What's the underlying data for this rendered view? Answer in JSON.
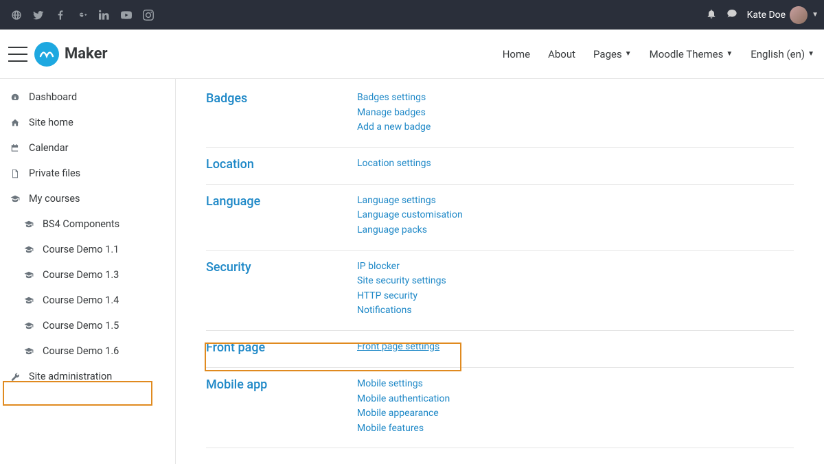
{
  "topbar": {
    "user_name": "Kate Doe"
  },
  "header": {
    "brand": "Maker",
    "nav": {
      "home": "Home",
      "about": "About",
      "pages": "Pages",
      "themes": "Moodle Themes",
      "lang": "English (en)"
    }
  },
  "sidebar": {
    "dashboard": "Dashboard",
    "sitehome": "Site home",
    "calendar": "Calendar",
    "privatefiles": "Private files",
    "mycourses": "My courses",
    "courses": [
      "BS4 Components",
      "Course Demo 1.1",
      "Course Demo 1.3",
      "Course Demo 1.4",
      "Course Demo 1.5",
      "Course Demo 1.6"
    ],
    "siteadmin": "Site administration"
  },
  "sections": {
    "badges": {
      "title": "Badges",
      "links": [
        "Badges settings",
        "Manage badges",
        "Add a new badge"
      ]
    },
    "location": {
      "title": "Location",
      "links": [
        "Location settings"
      ]
    },
    "language": {
      "title": "Language",
      "links": [
        "Language settings",
        "Language customisation",
        "Language packs"
      ]
    },
    "security": {
      "title": "Security",
      "links": [
        "IP blocker",
        "Site security settings",
        "HTTP security",
        "Notifications"
      ]
    },
    "frontpage": {
      "title": "Front page",
      "links": [
        "Front page settings"
      ]
    },
    "mobileapp": {
      "title": "Mobile app",
      "links": [
        "Mobile settings",
        "Mobile authentication",
        "Mobile appearance",
        "Mobile features"
      ]
    }
  }
}
